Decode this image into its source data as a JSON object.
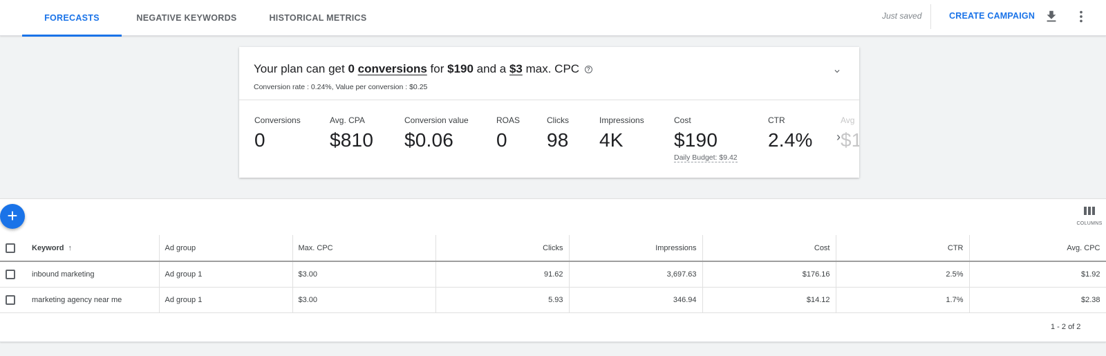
{
  "tabs": [
    {
      "label": "FORECASTS",
      "active": true
    },
    {
      "label": "NEGATIVE KEYWORDS",
      "active": false
    },
    {
      "label": "HISTORICAL METRICS",
      "active": false
    }
  ],
  "header": {
    "status": "Just saved",
    "create_label": "CREATE CAMPAIGN",
    "icons": [
      "download-icon",
      "more-vert-icon"
    ]
  },
  "plan": {
    "prefix": "Your plan can get",
    "conversions": "0",
    "conversions_word": "conversions",
    "for_word": "for",
    "amount": "$190",
    "and_a": "and a",
    "max_cpc": "$3",
    "suffix": "max. CPC",
    "subtitle": "Conversion rate : 0.24%, Value per conversion : $0.25"
  },
  "metrics": [
    {
      "label": "Conversions",
      "value": "0"
    },
    {
      "label": "Avg. CPA",
      "value": "$810"
    },
    {
      "label": "Conversion value",
      "value": "$0.06"
    },
    {
      "label": "ROAS",
      "value": "0"
    },
    {
      "label": "Clicks",
      "value": "98"
    },
    {
      "label": "Impressions",
      "value": "4K"
    },
    {
      "label": "Cost",
      "value": "$190"
    },
    {
      "label": "CTR",
      "value": "2.4%"
    },
    {
      "label": "Avg",
      "value": "$1"
    }
  ],
  "daily_budget": "Daily Budget: $9.42",
  "table": {
    "columns_label": "COLUMNS",
    "headers": [
      "Keyword",
      "Ad group",
      "Max. CPC",
      "Clicks",
      "Impressions",
      "Cost",
      "CTR",
      "Avg. CPC"
    ],
    "rows": [
      [
        "inbound marketing",
        "Ad group 1",
        "$3.00",
        "91.62",
        "3,697.63",
        "$176.16",
        "2.5%",
        "$1.92"
      ],
      [
        "marketing agency near me",
        "Ad group 1",
        "$3.00",
        "5.93",
        "346.94",
        "$14.12",
        "1.7%",
        "$2.38"
      ]
    ],
    "pagination": "1 - 2 of 2"
  }
}
